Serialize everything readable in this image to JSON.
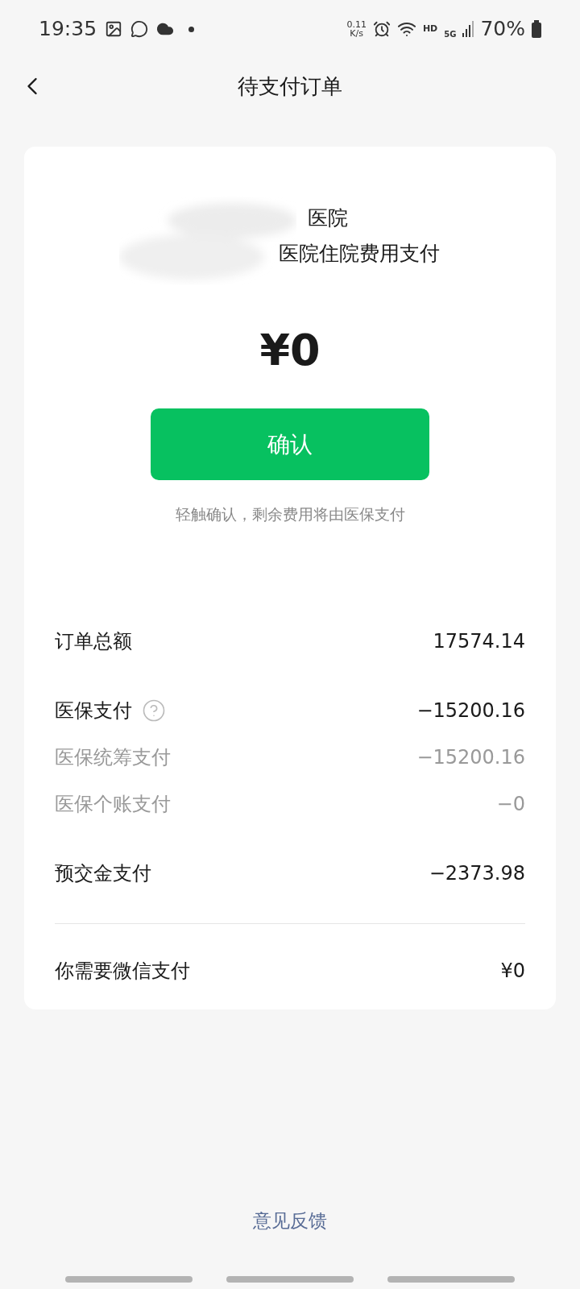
{
  "status_bar": {
    "time": "19:35",
    "net_speed": [
      "0.11",
      "K/s"
    ],
    "hd": "HD",
    "network": "5G",
    "battery": "70%"
  },
  "header": {
    "title": "待支付订单"
  },
  "order": {
    "hospital_lines": [
      "医院",
      "医院住院费用支付"
    ],
    "amount": "¥0",
    "confirm_button": "确认",
    "hint": "轻触确认，剩余费用将由医保支付"
  },
  "breakdown": [
    {
      "kind": "main",
      "label": "订单总额",
      "value": "17574.14",
      "help": false
    },
    {
      "kind": "main",
      "label": "医保支付",
      "value": "−15200.16",
      "help": true
    },
    {
      "kind": "sub",
      "label": "医保统筹支付",
      "value": "−15200.16",
      "help": false
    },
    {
      "kind": "sub",
      "label": "医保个账支付",
      "value": "−0",
      "help": false
    },
    {
      "kind": "main",
      "label": "预交金支付",
      "value": "−2373.98",
      "help": false
    }
  ],
  "total": {
    "label": "你需要微信支付",
    "value": "¥0"
  },
  "feedback_link": "意见反馈"
}
